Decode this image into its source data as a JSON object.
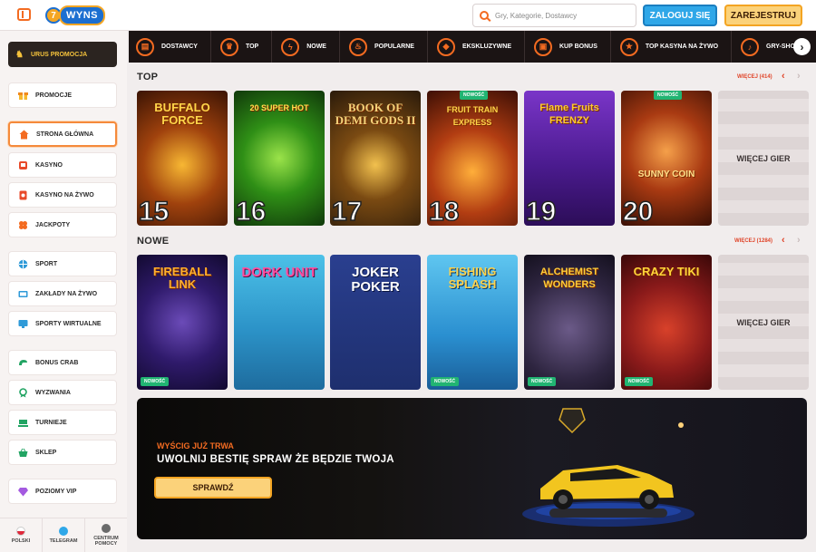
{
  "header": {
    "search_placeholder": "Gry, Kategorie, Dostawcy",
    "login_label": "ZALOGUJ SIĘ",
    "register_label": "ZAREJESTRUJ",
    "logo_text": "WYNS"
  },
  "sidebar": {
    "promo": "URUS PROMOCJA",
    "items": [
      {
        "label": "PROMOCJE",
        "icon": "gift-icon",
        "color": "#f5b82e"
      },
      {
        "label": "STRONA GŁÓWNA",
        "icon": "home-icon",
        "color": "#f36b21"
      },
      {
        "label": "KASYNO",
        "icon": "slot-icon",
        "color": "#e84a2a"
      },
      {
        "label": "KASYNO NA ŻYWO",
        "icon": "live-casino-icon",
        "color": "#e84a2a"
      },
      {
        "label": "JACKPOTY",
        "icon": "clover-icon",
        "color": "#f36b21"
      },
      {
        "label": "SPORT",
        "icon": "ball-icon",
        "color": "#2f9ad8"
      },
      {
        "label": "ZAKŁADY NA ŻYWO",
        "icon": "tv-icon",
        "color": "#2f9ad8"
      },
      {
        "label": "SPORTY WIRTUALNE",
        "icon": "monitor-icon",
        "color": "#2f9ad8"
      },
      {
        "label": "BONUS CRAB",
        "icon": "crab-claw-icon",
        "color": "#22a463"
      },
      {
        "label": "WYZWANIA",
        "icon": "medal-icon",
        "color": "#22a463"
      },
      {
        "label": "TURNIEJE",
        "icon": "trophy-icon",
        "color": "#22a463"
      },
      {
        "label": "SKLEP",
        "icon": "basket-icon",
        "color": "#22a463"
      },
      {
        "label": "POZIOMY VIP",
        "icon": "diamond-icon",
        "color": "#a45ae0"
      }
    ],
    "footer": [
      {
        "label": "POLSKI"
      },
      {
        "label": "TELEGRAM"
      },
      {
        "label": "CENTRUM POMOCY"
      }
    ]
  },
  "categories": [
    "DOSTAWCY",
    "TOP",
    "NOWE",
    "POPULARNE",
    "EKSKLUZYWNE",
    "KUP BONUS",
    "TOP KASYNA NA ŻYWO",
    "GRY-SHOW"
  ],
  "top": {
    "title": "TOP",
    "more": "WIĘCEJ (414)",
    "more_tile": "WIĘCEJ GIER",
    "games": [
      {
        "name": "BUFFALO FORCE",
        "rank": "15"
      },
      {
        "name": "20 SUPER HOT",
        "rank": "16"
      },
      {
        "name": "BOOK OF DEMI GODS II",
        "rank": "17"
      },
      {
        "name": "FRUIT TRAIN EXPRESS",
        "rank": "18",
        "badge": "NOWOŚĆ"
      },
      {
        "name": "Flame Fruits FRENZY",
        "rank": "19"
      },
      {
        "name": "SUNNY COIN",
        "rank": "20",
        "badge": "NOWOŚĆ"
      }
    ]
  },
  "new": {
    "title": "NOWE",
    "more": "WIĘCEJ (1284)",
    "more_tile": "WIĘCEJ GIER",
    "games": [
      {
        "name": "FIREBALL LINK",
        "badge": "NOWOŚĆ"
      },
      {
        "name": "DORK UNIT"
      },
      {
        "name": "JOKER POKER"
      },
      {
        "name": "FISHING SPLASH",
        "badge": "NOWOŚĆ"
      },
      {
        "name": "ALCHEMIST WONDERS",
        "badge": "NOWOŚĆ"
      },
      {
        "name": "CRAZY TIKI",
        "badge": "NOWOŚĆ"
      }
    ]
  },
  "banner": {
    "subtitle": "WYŚCIG JUŻ TRWA",
    "title": "UWOLNIJ BESTIĘ  SPRAW ŻE BĘDZIE TWOJA",
    "button": "SPRAWDŹ"
  },
  "colors": {
    "accent": "#f36b21",
    "login": "#2fa7e8",
    "register": "#fbd27a",
    "new_badge": "#21b472"
  }
}
